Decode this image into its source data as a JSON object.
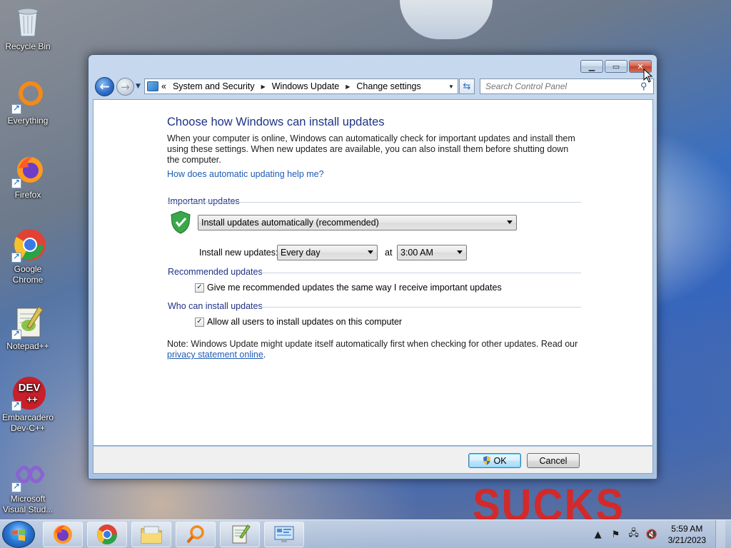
{
  "desktop": {
    "icons": [
      {
        "label": "Recycle Bin",
        "icon": "recycle-bin-icon"
      },
      {
        "label": "Everything",
        "icon": "everything-icon"
      },
      {
        "label": "Firefox",
        "icon": "firefox-icon"
      },
      {
        "label": "Google Chrome",
        "icon": "chrome-icon"
      },
      {
        "label": "Notepad++",
        "icon": "notepadpp-icon"
      },
      {
        "label": "Embarcadero Dev-C++",
        "icon": "devcpp-icon"
      },
      {
        "label": "Microsoft Visual Stud...",
        "icon": "visual-studio-icon"
      }
    ],
    "wallpaper_text": "SUCKS"
  },
  "window": {
    "breadcrumb": [
      "System and Security",
      "Windows Update",
      "Change settings"
    ],
    "breadcrumb_prefix": "«",
    "search_placeholder": "Search Control Panel",
    "title": "Choose how Windows can install updates",
    "description": "When your computer is online, Windows can automatically check for important updates and install them using these settings. When new updates are available, you can also install them before shutting down the computer.",
    "help_link": "How does automatic updating help me?",
    "important_updates": {
      "heading": "Important updates",
      "selected_option": "Install updates automatically (recommended)",
      "schedule_label": "Install new updates:",
      "day_value": "Every day",
      "at_label": "at",
      "time_value": "3:00 AM"
    },
    "recommended_updates": {
      "heading": "Recommended updates",
      "checkbox_label": "Give me recommended updates the same way I receive important updates",
      "checked": true
    },
    "who_can_install": {
      "heading": "Who can install updates",
      "checkbox_label": "Allow all users to install updates on this computer",
      "checked": true
    },
    "note_text": "Note: Windows Update might update itself automatically first when checking for other updates.  Read our",
    "note_link": "privacy statement online",
    "note_end": ".",
    "ok_label": "OK",
    "cancel_label": "Cancel"
  },
  "taskbar": {
    "pinned": [
      "firefox-icon",
      "chrome-icon",
      "file-explorer-icon",
      "everything-icon",
      "notepadpp-icon",
      "control-panel-icon"
    ],
    "clock_time": "5:59 AM",
    "clock_date": "3/21/2023"
  }
}
